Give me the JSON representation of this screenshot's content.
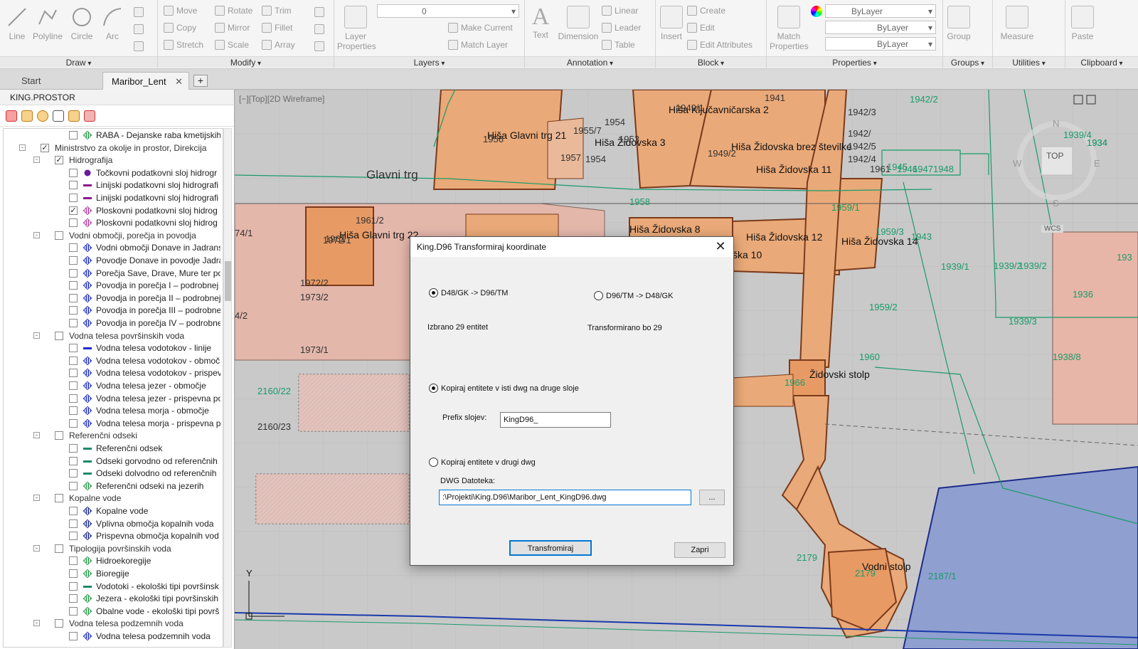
{
  "ribbon": {
    "panels": [
      "Draw",
      "Modify",
      "Layers",
      "Annotation",
      "Block",
      "Properties",
      "Groups",
      "Utilities",
      "Clipboard"
    ],
    "draw": {
      "line": "Line",
      "polyline": "Polyline",
      "circle": "Circle",
      "arc": "Arc"
    },
    "modify": {
      "move": "Move",
      "rotate": "Rotate",
      "trim": "Trim",
      "copy": "Copy",
      "mirror": "Mirror",
      "fillet": "Fillet",
      "stretch": "Stretch",
      "scale": "Scale",
      "array": "Array"
    },
    "layers": {
      "layer_properties": "Layer Properties",
      "current_layer": "0",
      "make_current": "Make Current",
      "match_layer": "Match Layer"
    },
    "annotation": {
      "text": "Text",
      "dimension": "Dimension",
      "linear": "Linear",
      "leader": "Leader",
      "table": "Table"
    },
    "block": {
      "insert": "Insert",
      "create": "Create",
      "edit": "Edit",
      "edit_attributes": "Edit Attributes"
    },
    "properties": {
      "match_properties": "Match Properties",
      "color": "ByLayer",
      "linetype": "ByLayer",
      "lineweight": "ByLayer"
    },
    "groups": {
      "group": "Group"
    },
    "utilities": {
      "measure": "Measure"
    },
    "clipboard": {
      "paste": "Paste"
    }
  },
  "tabs": [
    {
      "label": "Start"
    },
    {
      "label": "Maribor_Lent"
    }
  ],
  "palette": {
    "title": "KING.PROSTOR",
    "tree": [
      {
        "label": "RABA - Dejanske raba kmetijskih",
        "level": 4,
        "checked": false,
        "icon": "poly-green",
        "expander": ""
      },
      {
        "label": "Ministrstvo za okolje in prostor, Direkcija",
        "level": 2,
        "checked": true,
        "icon": "",
        "expander": "-"
      },
      {
        "label": "Hidrografija",
        "level": 3,
        "checked": true,
        "icon": "",
        "expander": "-",
        "bold": false
      },
      {
        "label": "Točkovni podatkovni sloj hidrogr",
        "level": 4,
        "checked": false,
        "icon": "dot-purple",
        "expander": ""
      },
      {
        "label": "Linijski podatkovni sloj hidrografi",
        "level": 4,
        "checked": false,
        "icon": "line-purple",
        "expander": ""
      },
      {
        "label": "Linijski podatkovni sloj hidrografi",
        "level": 4,
        "checked": false,
        "icon": "line-purple",
        "expander": ""
      },
      {
        "label": "Ploskovni podatkovni sloj hidrog",
        "level": 4,
        "checked": true,
        "icon": "poly-pink",
        "expander": ""
      },
      {
        "label": "Ploskovni podatkovni sloj hidrog",
        "level": 4,
        "checked": false,
        "icon": "poly-pink",
        "expander": ""
      },
      {
        "label": "Vodni območji, porečja in povodja",
        "level": 3,
        "checked": false,
        "icon": "",
        "expander": "-"
      },
      {
        "label": "Vodni območji Donave in Jadrans",
        "level": 4,
        "checked": false,
        "icon": "poly-blue",
        "expander": ""
      },
      {
        "label": "Povodje Donave in povodje Jadra",
        "level": 4,
        "checked": false,
        "icon": "poly-blue",
        "expander": ""
      },
      {
        "label": "Porečja Save, Drave, Mure ter po",
        "level": 4,
        "checked": false,
        "icon": "poly-blue",
        "expander": ""
      },
      {
        "label": "Povodja in porečja I – podrobnej",
        "level": 4,
        "checked": false,
        "icon": "poly-blue",
        "expander": ""
      },
      {
        "label": "Povodja in porečja II – podrobnej",
        "level": 4,
        "checked": false,
        "icon": "poly-blue",
        "expander": ""
      },
      {
        "label": "Povodja in porečja III – podrobne",
        "level": 4,
        "checked": false,
        "icon": "poly-blue",
        "expander": ""
      },
      {
        "label": "Povodja in porečja IV – podrobne",
        "level": 4,
        "checked": false,
        "icon": "poly-blue",
        "expander": ""
      },
      {
        "label": "Vodna telesa površinskih voda",
        "level": 3,
        "checked": false,
        "icon": "",
        "expander": "-"
      },
      {
        "label": "Vodna telesa vodotokov - linije",
        "level": 4,
        "checked": false,
        "icon": "line-blue",
        "expander": ""
      },
      {
        "label": "Vodna telesa vodotokov - območ",
        "level": 4,
        "checked": false,
        "icon": "poly-blue",
        "expander": ""
      },
      {
        "label": "Vodna telesa vodotokov - prispev",
        "level": 4,
        "checked": false,
        "icon": "poly-blue",
        "expander": ""
      },
      {
        "label": "Vodna telesa jezer - območje",
        "level": 4,
        "checked": false,
        "icon": "poly-blue",
        "expander": ""
      },
      {
        "label": "Vodna telesa jezer - prispevna po",
        "level": 4,
        "checked": false,
        "icon": "poly-blue",
        "expander": ""
      },
      {
        "label": "Vodna telesa morja - območje",
        "level": 4,
        "checked": false,
        "icon": "poly-blue",
        "expander": ""
      },
      {
        "label": "Vodna telesa morja - prispevna po",
        "level": 4,
        "checked": false,
        "icon": "poly-blue",
        "expander": ""
      },
      {
        "label": "Referenčni odseki",
        "level": 3,
        "checked": false,
        "icon": "",
        "expander": "-"
      },
      {
        "label": "Referenčni odsek",
        "level": 4,
        "checked": false,
        "icon": "line-teal",
        "expander": ""
      },
      {
        "label": "Odseki gorvodno od referenčnih",
        "level": 4,
        "checked": false,
        "icon": "line-teal",
        "expander": ""
      },
      {
        "label": "Odseki dolvodno od referenčnih",
        "level": 4,
        "checked": false,
        "icon": "line-teal",
        "expander": ""
      },
      {
        "label": "Referenčni odseki na jezerih",
        "level": 4,
        "checked": false,
        "icon": "poly-green",
        "expander": ""
      },
      {
        "label": "Kopalne vode",
        "level": 3,
        "checked": false,
        "icon": "",
        "expander": "-"
      },
      {
        "label": "Kopalne vode",
        "level": 4,
        "checked": false,
        "icon": "poly-navy",
        "expander": ""
      },
      {
        "label": "Vplivna območja kopalnih voda",
        "level": 4,
        "checked": false,
        "icon": "poly-navy",
        "expander": ""
      },
      {
        "label": "Prispevna območja kopalnih vod",
        "level": 4,
        "checked": false,
        "icon": "poly-navy",
        "expander": ""
      },
      {
        "label": "Tipologija površinskih voda",
        "level": 3,
        "checked": false,
        "icon": "",
        "expander": "-"
      },
      {
        "label": "Hidroekoregije",
        "level": 4,
        "checked": false,
        "icon": "poly-green",
        "expander": ""
      },
      {
        "label": "Bioregije",
        "level": 4,
        "checked": false,
        "icon": "poly-green",
        "expander": ""
      },
      {
        "label": "Vodotoki - ekološki tipi površinsk",
        "level": 4,
        "checked": false,
        "icon": "line-teal",
        "expander": ""
      },
      {
        "label": "Jezera - ekološki tipi površinskih v",
        "level": 4,
        "checked": false,
        "icon": "poly-green",
        "expander": ""
      },
      {
        "label": "Obalne vode - ekološki tipi površ",
        "level": 4,
        "checked": false,
        "icon": "poly-green",
        "expander": ""
      },
      {
        "label": "Vodna telesa podzemnih voda",
        "level": 3,
        "checked": false,
        "icon": "",
        "expander": "-"
      },
      {
        "label": "Vodna telesa podzemnih voda",
        "level": 4,
        "checked": false,
        "icon": "poly-blue",
        "expander": ""
      }
    ]
  },
  "viewport": {
    "view_label": "[−][Top][2D Wireframe]",
    "street": "Glavni trg",
    "buildings": [
      "Hiša Glavni trg 21",
      "Hiša Židovska 3",
      "Hiša Ključavničarska 2",
      "Hiša Židovska brez številke",
      "Hiša Židovska 11",
      "Hiša Glavni trg 2?",
      "Hiša Židovska 8",
      "Hiša Židovska 12",
      "Hiša Židovska 14",
      "ška 10",
      "Židovski stolp",
      "Vodni stolp"
    ],
    "parcels_gray": [
      "1941",
      "1949/1",
      "1954",
      "1953",
      "1957",
      "1954",
      "1956",
      "1955/7",
      "1949/2",
      "1942/3",
      "1942/",
      "1942/5",
      "1942/4",
      "1961",
      "1961",
      "1961/2",
      "1973/2",
      "1973/1",
      "2160/23",
      "74/1",
      "4/2",
      "1972/1",
      "1972/2"
    ],
    "parcels_green": [
      "1942/2",
      "1934",
      "1939/4",
      "1934",
      "1945",
      "1946",
      "1947",
      "1948",
      "1958",
      "1959/1",
      "1959/3",
      "1943",
      "1939/1",
      "1939/2",
      "1939/2",
      "1936",
      "1959/2",
      "1939/3",
      "1960",
      "1938/8",
      "1966",
      "2179",
      "2179",
      "2187/1",
      "2160/22",
      "193"
    ],
    "compass": {
      "n": "N",
      "s": "S",
      "e": "E",
      "w": "W",
      "top": "TOP",
      "wcs": "WCS"
    },
    "ucs_y": "Y"
  },
  "dialog": {
    "title": "King.D96 Transformiraj koordinate",
    "radio_d48_to_d96": "D48/GK -> D96/TM",
    "radio_d96_to_d48": "D96/TM -> D48/GK",
    "selected_text": "Izbrano 29 entitet",
    "transformed_text": "Transformirano bo 29",
    "radio_copy_same": "Kopiraj entitete v isti dwg na druge sloje",
    "prefix_label": "Prefix slojev:",
    "prefix_value": "KingD96_",
    "radio_copy_other": "Kopiraj entitete v drugi dwg",
    "dwg_label": "DWG Datoteka:",
    "dwg_value": ":\\Projekti\\King.D96\\Maribor_Lent_KingD96.dwg",
    "browse_label": "...",
    "transform_button": "Transfromiraj",
    "close_button": "Zapri"
  }
}
